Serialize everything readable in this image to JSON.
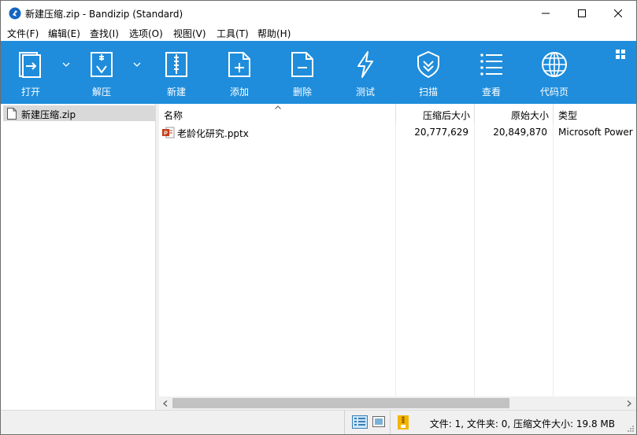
{
  "window": {
    "title": "新建压缩.zip - Bandizip (Standard)",
    "icon": "bandizip-logo-icon"
  },
  "menu": [
    "文件(F)",
    "编辑(E)",
    "查找(I)",
    "选项(O)",
    "视图(V)",
    "工具(T)",
    "帮助(H)"
  ],
  "toolbar": {
    "open": "打开",
    "extract": "解压",
    "new": "新建",
    "add": "添加",
    "delete": "删除",
    "test": "测试",
    "scan": "扫描",
    "view": "查看",
    "codepage": "代码页"
  },
  "tree": {
    "item": "新建压缩.zip"
  },
  "columns": {
    "name": "名称",
    "compressed": "压缩后大小",
    "original": "原始大小",
    "type": "类型"
  },
  "files": [
    {
      "name": "老龄化研究.pptx",
      "compressed": "20,777,629",
      "original": "20,849,870",
      "type": "Microsoft Power"
    }
  ],
  "status": {
    "text": "文件: 1, 文件夹: 0, 压缩文件大小: 19.8 MB"
  },
  "colors": {
    "toolbar": "#1f8ddb",
    "selection": "#d9d9d9"
  }
}
